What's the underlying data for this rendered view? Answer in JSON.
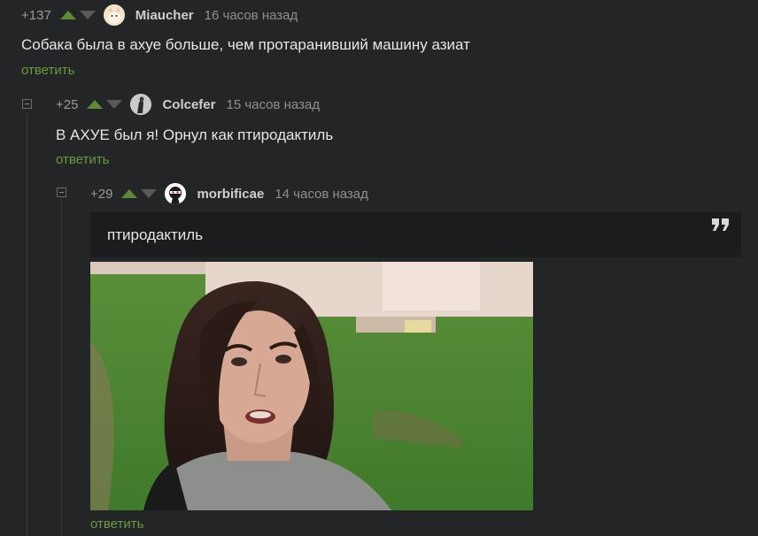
{
  "comments": [
    {
      "rating": "+137",
      "author": "Miaucher",
      "time": "16 часов назад",
      "text": "Собака была в ахуе больше, чем протаранивший машину азиат",
      "reply_label": "ответить"
    },
    {
      "rating": "+25",
      "author": "Colcefer",
      "time": "15 часов назад",
      "text": "В АХУЕ был я! Орнул как птиродактиль",
      "reply_label": "ответить"
    },
    {
      "rating": "+29",
      "author": "morbificae",
      "time": "14 часов назад",
      "quote": "птиродактиль",
      "image_icon": "photo-woman-frowning",
      "reply_label": "ответить"
    }
  ],
  "colors": {
    "background": "#242526",
    "reply_link": "#6a9b3d",
    "upvote": "#5c8a38",
    "downvote": "#5a5a5a",
    "quote_bg": "#1b1c1d"
  },
  "icons": {
    "upvote": "arrow-up-icon",
    "downvote": "arrow-down-icon",
    "collapse": "minus-box-icon",
    "quote": "quote-icon"
  }
}
